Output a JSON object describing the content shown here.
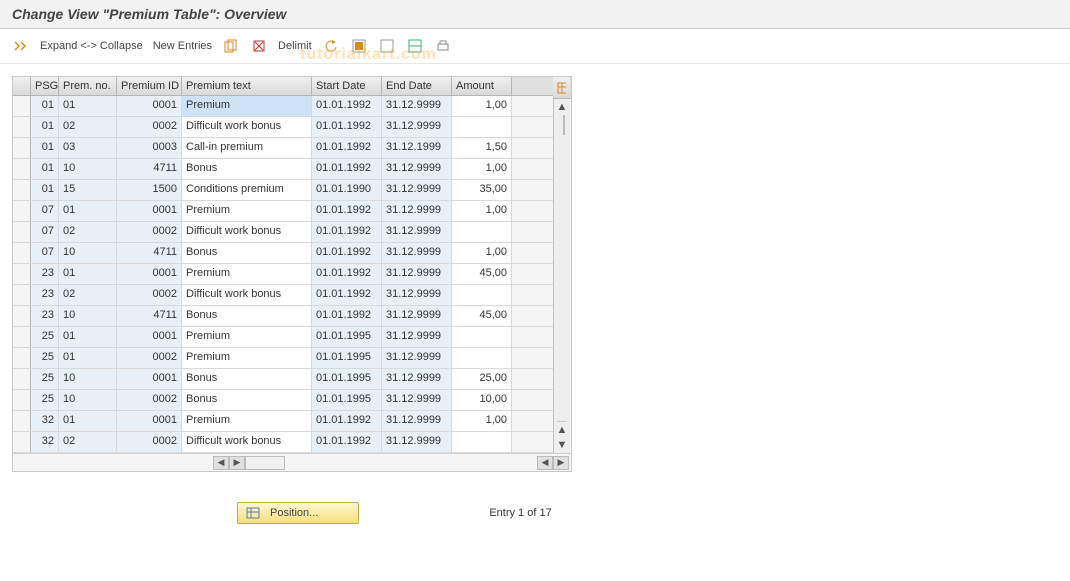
{
  "header": {
    "title": "Change View \"Premium Table\": Overview"
  },
  "toolbar": {
    "expand_collapse": "Expand <-> Collapse",
    "new_entries": "New Entries",
    "delimit": "Delimit"
  },
  "watermark": "tutorialkart.com",
  "columns": {
    "sel": "",
    "psg": "PSG",
    "premno": "Prem. no.",
    "premid": "Premium ID",
    "premtext": "Premium text",
    "startdate": "Start Date",
    "enddate": "End Date",
    "amount": "Amount"
  },
  "rows": [
    {
      "psg": "01",
      "premno": "01",
      "premid": "0001",
      "premtext": "Premium",
      "start": "01.01.1992",
      "end": "31.12.9999",
      "amount": "1,00"
    },
    {
      "psg": "01",
      "premno": "02",
      "premid": "0002",
      "premtext": "Difficult work bonus",
      "start": "01.01.1992",
      "end": "31.12.9999",
      "amount": ""
    },
    {
      "psg": "01",
      "premno": "03",
      "premid": "0003",
      "premtext": "Call-in premium",
      "start": "01.01.1992",
      "end": "31.12.1999",
      "amount": "1,50"
    },
    {
      "psg": "01",
      "premno": "10",
      "premid": "4711",
      "premtext": "Bonus",
      "start": "01.01.1992",
      "end": "31.12.9999",
      "amount": "1,00"
    },
    {
      "psg": "01",
      "premno": "15",
      "premid": "1500",
      "premtext": "Conditions premium",
      "start": "01.01.1990",
      "end": "31.12.9999",
      "amount": "35,00"
    },
    {
      "psg": "07",
      "premno": "01",
      "premid": "0001",
      "premtext": "Premium",
      "start": "01.01.1992",
      "end": "31.12.9999",
      "amount": "1,00"
    },
    {
      "psg": "07",
      "premno": "02",
      "premid": "0002",
      "premtext": "Difficult work bonus",
      "start": "01.01.1992",
      "end": "31.12.9999",
      "amount": ""
    },
    {
      "psg": "07",
      "premno": "10",
      "premid": "4711",
      "premtext": "Bonus",
      "start": "01.01.1992",
      "end": "31.12.9999",
      "amount": "1,00"
    },
    {
      "psg": "23",
      "premno": "01",
      "premid": "0001",
      "premtext": "Premium",
      "start": "01.01.1992",
      "end": "31.12.9999",
      "amount": "45,00"
    },
    {
      "psg": "23",
      "premno": "02",
      "premid": "0002",
      "premtext": "Difficult work bonus",
      "start": "01.01.1992",
      "end": "31.12.9999",
      "amount": ""
    },
    {
      "psg": "23",
      "premno": "10",
      "premid": "4711",
      "premtext": "Bonus",
      "start": "01.01.1992",
      "end": "31.12.9999",
      "amount": "45,00"
    },
    {
      "psg": "25",
      "premno": "01",
      "premid": "0001",
      "premtext": "Premium",
      "start": "01.01.1995",
      "end": "31.12.9999",
      "amount": ""
    },
    {
      "psg": "25",
      "premno": "01",
      "premid": "0002",
      "premtext": "Premium",
      "start": "01.01.1995",
      "end": "31.12.9999",
      "amount": ""
    },
    {
      "psg": "25",
      "premno": "10",
      "premid": "0001",
      "premtext": "Bonus",
      "start": "01.01.1995",
      "end": "31.12.9999",
      "amount": "25,00"
    },
    {
      "psg": "25",
      "premno": "10",
      "premid": "0002",
      "premtext": "Bonus",
      "start": "01.01.1995",
      "end": "31.12.9999",
      "amount": "10,00"
    },
    {
      "psg": "32",
      "premno": "01",
      "premid": "0001",
      "premtext": "Premium",
      "start": "01.01.1992",
      "end": "31.12.9999",
      "amount": "1,00"
    },
    {
      "psg": "32",
      "premno": "02",
      "premid": "0002",
      "premtext": "Difficult work bonus",
      "start": "01.01.1992",
      "end": "31.12.9999",
      "amount": ""
    }
  ],
  "footer": {
    "position_label": "Position...",
    "entry_text": "Entry 1 of 17"
  }
}
